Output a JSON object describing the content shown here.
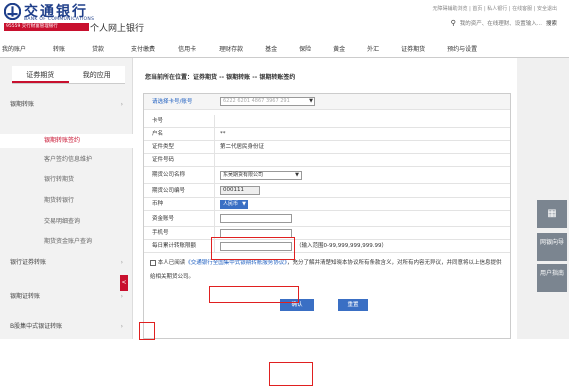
{
  "header": {
    "bank_cn": "交通银行",
    "bank_en": "BANK OF COMMUNICATIONS",
    "hotline": "95559 交行财富管理银行",
    "site_title": "个人网上银行",
    "toplinks": "无障碍辅助浏览 | 首页 | 私人银行 | 在线客服 | 安全退出",
    "search_placeholder": "我的资产、在线理财、设置输入...",
    "search_btn": "搜索",
    "brand_color": "#1f3f8a",
    "accent_color": "#c8102e"
  },
  "nav": [
    "我的账户",
    "转账",
    "贷款",
    "支付缴费",
    "信用卡",
    "理财存款",
    "基金",
    "保险",
    "黄金",
    "外汇",
    "证券期货",
    "预约与设置"
  ],
  "leftnav": {
    "tabs": [
      "证券期货",
      "我的应用"
    ],
    "items": [
      {
        "label": "银期转账",
        "type": "group"
      },
      {
        "label": "银期转账签约",
        "type": "sub",
        "active": true
      },
      {
        "label": "客户签约信息维护",
        "type": "sub"
      },
      {
        "label": "银行转期货",
        "type": "sub"
      },
      {
        "label": "期货转银行",
        "type": "sub"
      },
      {
        "label": "交易明细查询",
        "type": "sub"
      },
      {
        "label": "期货资金账户查询",
        "type": "sub"
      },
      {
        "label": "银行证券转账",
        "type": "group"
      },
      {
        "label": "银期证转账",
        "type": "group"
      },
      {
        "label": "B股集中式银证转账",
        "type": "group"
      }
    ],
    "collapse_glyph": "<"
  },
  "breadcrumb": "您当前所在位置：证券期货 -- 银期转账 -- 银期转账签约",
  "form": {
    "card_select_label": "请选择卡号/账号",
    "card_select_value": "6222 6201 4867 3967 291",
    "rows": [
      {
        "label": "卡号",
        "value": ""
      },
      {
        "label": "户名",
        "value": "**"
      },
      {
        "label": "证件类型",
        "value": "第二代居民身份证"
      },
      {
        "label": "证件号码",
        "value": ""
      },
      {
        "label": "期货公司名称",
        "value": "东吴期货有限公司"
      },
      {
        "label": "期货公司编号",
        "value": "000111"
      },
      {
        "label": "币种",
        "value": "人民币"
      },
      {
        "label": "资金账号",
        "value": ""
      },
      {
        "label": "手机号",
        "value": ""
      },
      {
        "label": "每日累计转账限额",
        "value": "",
        "hint": "（输入范围0-99,999,999,999.99）"
      }
    ],
    "agreement_prefix": "本人已阅读",
    "agreement_link": "《交通银行全国集中式银期转账服务协议》",
    "agreement_suffix": "，充分了解并清楚知晓本协议所有条款含义，对所有内容无异议，并同意将以上信息提供给相关期货公司。",
    "confirm_btn": "确认",
    "reset_btn": "重置"
  },
  "side": {
    "qr": "二维码",
    "guide": "网银向导",
    "manual": "用户指南"
  }
}
